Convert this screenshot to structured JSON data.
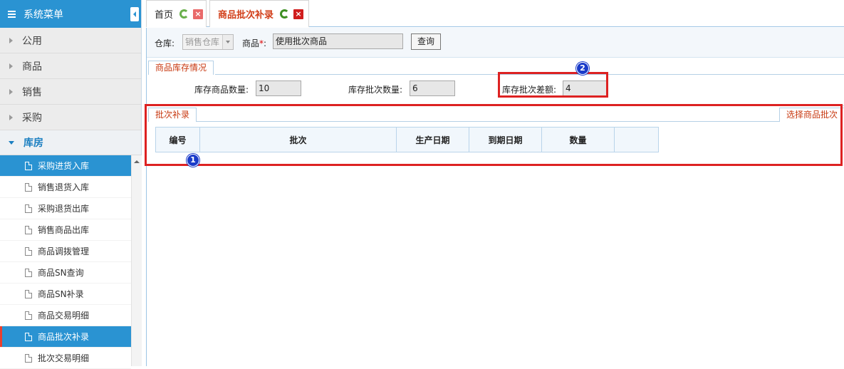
{
  "sidebar": {
    "title": "系统菜单",
    "groups": [
      {
        "label": "公用"
      },
      {
        "label": "商品"
      },
      {
        "label": "销售"
      },
      {
        "label": "采购"
      },
      {
        "label": "库房"
      }
    ],
    "items": [
      {
        "label": "采购进货入库"
      },
      {
        "label": "销售退货入库"
      },
      {
        "label": "采购退货出库"
      },
      {
        "label": "销售商品出库"
      },
      {
        "label": "商品调拨管理"
      },
      {
        "label": "商品SN查询"
      },
      {
        "label": "商品SN补录"
      },
      {
        "label": "商品交易明细"
      },
      {
        "label": "商品批次补录"
      },
      {
        "label": "批次交易明细"
      }
    ]
  },
  "tabs": [
    {
      "label": "首页"
    },
    {
      "label": "商品批次补录"
    }
  ],
  "filter": {
    "warehouse_label": "仓库:",
    "warehouse_value": "销售仓库",
    "product_label": "商品",
    "required_mark": "*",
    "colon": ":",
    "product_value": "使用批次商品",
    "query_button": "查询"
  },
  "stock": {
    "tab_label": "商品库存情况",
    "qty_label": "库存商品数量:",
    "qty_value": "10",
    "batch_qty_label": "库存批次数量:",
    "batch_qty_value": "6",
    "diff_label": "库存批次差额:",
    "diff_value": "4"
  },
  "batch": {
    "tab_label": "批次补录",
    "select_link": "选择商品批次",
    "columns": [
      "编号",
      "批次",
      "生产日期",
      "到期日期",
      "数量",
      ""
    ]
  },
  "annotations": {
    "badge1": "1",
    "badge2": "2"
  },
  "colors": {
    "accent": "#2a93d2",
    "highlight_red": "#dd2222",
    "badge_blue": "#1a3bc9"
  }
}
